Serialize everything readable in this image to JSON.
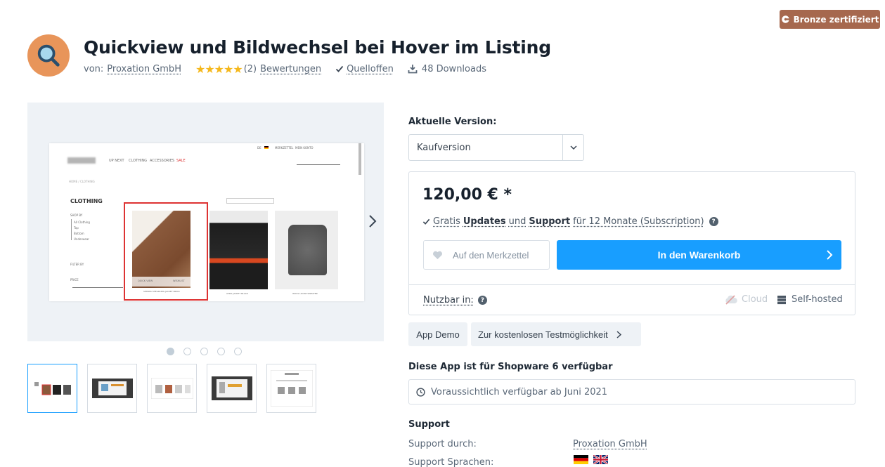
{
  "badge": {
    "label": "Bronze zertifiziert"
  },
  "header": {
    "title": "Quickview und Bildwechsel bei Hover im Listing",
    "by_prefix": "von:",
    "vendor": "Proxation GmbH",
    "stars": "★★★★★",
    "rating_count": "(2)",
    "ratings_label": "Bewertungen",
    "open_source": "Quelloffen",
    "downloads": "48 Downloads"
  },
  "gallery": {
    "mock": {
      "nav": [
        "UP NEXT",
        "CLOTHING",
        "ACCESSORIES",
        "SALE"
      ],
      "topbar": [
        "MERKZETTEL",
        "MEIN KONTO"
      ],
      "breadcrumb": "HOME / CLOTHING",
      "heading": "CLOTHING",
      "shop_by": "SHOP BY",
      "filters": [
        "All Clothing",
        "Top",
        "Bottom",
        "Underwear"
      ],
      "filter_by": "FILTER BY",
      "price": "PRICE",
      "quick_view": "QUICK VIEW",
      "wishlist": "WISHLIST",
      "products": [
        "SHERPA SHEARLING JACKET BRICK",
        "AVRIL JACKET BLACK",
        "WOOL LOOSE SWEATER"
      ]
    },
    "dots": 5,
    "thumbs": 5
  },
  "purchase": {
    "version_label": "Aktuelle Version:",
    "version_value": "Kaufversion",
    "price": "120,00 € *",
    "updates": {
      "p1": "Gratis",
      "p2": "Updates",
      "p3": "und",
      "p4": "Support",
      "p5": "für 12 Monate (Subscription)"
    },
    "wishlist_label": "Auf den Merkzettel",
    "cart_label": "In den Warenkorb",
    "usable_label": "Nutzbar in:",
    "cloud_label": "Cloud",
    "selfhosted_label": "Self-hosted"
  },
  "actions": {
    "demo_label": "App Demo",
    "trial_label": "Zur kostenlosen Testmöglichkeit"
  },
  "sw6": {
    "heading": "Diese App ist für Shopware 6 verfügbar",
    "availability": "Voraussichtlich verfügbar ab Juni 2021"
  },
  "support": {
    "heading": "Support",
    "by_label": "Support durch:",
    "by_value": "Proxation GmbH",
    "languages_label": "Support Sprachen:"
  },
  "colors": {
    "accent": "#189eff",
    "badge": "#a6684e",
    "logo_bg": "#e8955a",
    "stars": "#f5b81c"
  }
}
